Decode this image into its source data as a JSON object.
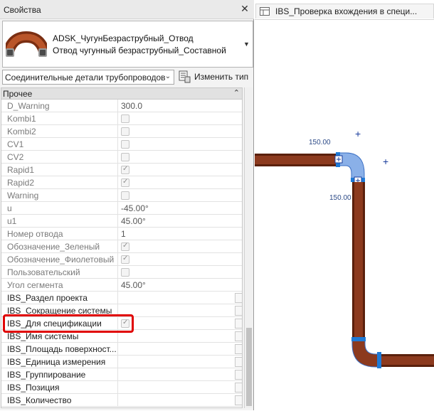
{
  "palette": {
    "title": "Свойства",
    "close_icon": "close-icon"
  },
  "type_selector": {
    "family": "ADSK_ЧугунБезраструбный_Отвод",
    "type": "Отвод чугунный безраструбный_Составной",
    "thumbnail_icon": "pipe-elbow-icon"
  },
  "filter": {
    "selected": "Соединительные детали трубопроводов",
    "edit_type_label": "Изменить тип"
  },
  "group": {
    "label": "Прочее"
  },
  "rows": [
    {
      "name": "D_Warning",
      "value": "300.0"
    },
    {
      "name": "Kombi1",
      "value": "",
      "checkbox": false
    },
    {
      "name": "Kombi2",
      "value": "",
      "checkbox": false
    },
    {
      "name": "CV1",
      "value": "",
      "checkbox": false
    },
    {
      "name": "CV2",
      "value": "",
      "checkbox": false
    },
    {
      "name": "Rapid1",
      "value": "",
      "checkbox": true
    },
    {
      "name": "Rapid2",
      "value": "",
      "checkbox": true
    },
    {
      "name": "Warning",
      "value": "",
      "checkbox": false
    },
    {
      "name": "u",
      "value": "-45.00°"
    },
    {
      "name": "u1",
      "value": "45.00°"
    },
    {
      "name": "Номер отвода",
      "value": "1"
    },
    {
      "name": "Обозначение_Зеленый",
      "value": "",
      "checkbox": true
    },
    {
      "name": "Обозначение_Фиолетовый",
      "value": "",
      "checkbox": true
    },
    {
      "name": "Пользовательский",
      "value": "",
      "checkbox": false
    },
    {
      "name": "Угол сегмента",
      "value": "45.00°"
    },
    {
      "name": "IBS_Раздел проекта",
      "value": ""
    },
    {
      "name": "IBS_Сокращение системы",
      "value": ""
    },
    {
      "name": "IBS_Для спецификации",
      "value": "",
      "checkbox": true
    },
    {
      "name": "IBS_Имя системы",
      "value": ""
    },
    {
      "name": "IBS_Площадь поверхност...",
      "value": ""
    },
    {
      "name": "IBS_Единица измерения",
      "value": ""
    },
    {
      "name": "IBS_Группирование",
      "value": ""
    },
    {
      "name": "IBS_Позиция",
      "value": ""
    },
    {
      "name": "IBS_Количество",
      "value": ""
    }
  ],
  "view": {
    "tab_label": "IBS_Проверка вхождения в специ...",
    "tab_icon": "view-plan-icon",
    "dim_top": "150.00",
    "dim_right": "150.00",
    "colors": {
      "pipe": "#8c3a1e",
      "pipe_dark": "#4a1a0a",
      "selected_elbow": "#8ab0e8",
      "connector_blue": "#1e7ad6",
      "highlight_red": "#e00000"
    }
  }
}
